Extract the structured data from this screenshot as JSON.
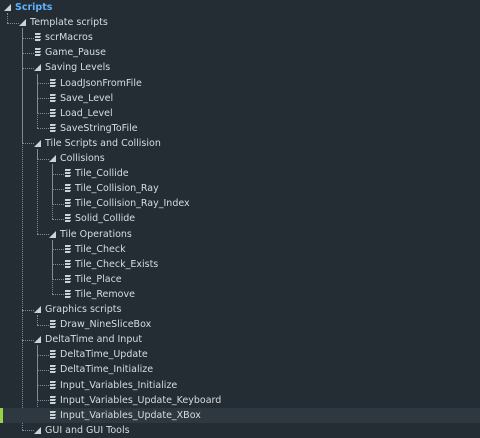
{
  "tree": [
    {
      "label": "Scripts",
      "level": 0,
      "type": "folder",
      "root": true
    },
    {
      "label": "Template scripts",
      "level": 1,
      "type": "folder"
    },
    {
      "label": "scrMacros",
      "level": 2,
      "type": "script"
    },
    {
      "label": "Game_Pause",
      "level": 2,
      "type": "script"
    },
    {
      "label": "Saving Levels",
      "level": 2,
      "type": "folder"
    },
    {
      "label": "LoadJsonFromFile",
      "level": 3,
      "type": "script"
    },
    {
      "label": "Save_Level",
      "level": 3,
      "type": "script"
    },
    {
      "label": "Load_Level",
      "level": 3,
      "type": "script"
    },
    {
      "label": "SaveStringToFile",
      "level": 3,
      "type": "script"
    },
    {
      "label": "Tile Scripts and Collision",
      "level": 2,
      "type": "folder"
    },
    {
      "label": "Collisions",
      "level": 3,
      "type": "folder"
    },
    {
      "label": "Tile_Collide",
      "level": 4,
      "type": "script"
    },
    {
      "label": "Tile_Collision_Ray",
      "level": 4,
      "type": "script"
    },
    {
      "label": "Tile_Collision_Ray_Index",
      "level": 4,
      "type": "script"
    },
    {
      "label": "Solid_Collide",
      "level": 4,
      "type": "script"
    },
    {
      "label": "Tile Operations",
      "level": 3,
      "type": "folder"
    },
    {
      "label": "Tile_Check",
      "level": 4,
      "type": "script"
    },
    {
      "label": "Tile_Check_Exists",
      "level": 4,
      "type": "script"
    },
    {
      "label": "Tile_Place",
      "level": 4,
      "type": "script"
    },
    {
      "label": "Tile_Remove",
      "level": 4,
      "type": "script"
    },
    {
      "label": "Graphics scripts",
      "level": 2,
      "type": "folder"
    },
    {
      "label": "Draw_NineSliceBox",
      "level": 3,
      "type": "script"
    },
    {
      "label": "DeltaTime and Input",
      "level": 2,
      "type": "folder"
    },
    {
      "label": "DeltaTime_Update",
      "level": 3,
      "type": "script"
    },
    {
      "label": "DeltaTime_Initialize",
      "level": 3,
      "type": "script"
    },
    {
      "label": "Input_Variables_Initialize",
      "level": 3,
      "type": "script"
    },
    {
      "label": "Input_Variables_Update_Keyboard",
      "level": 3,
      "type": "script"
    },
    {
      "label": "Input_Variables_Update_XBox",
      "level": 3,
      "type": "script",
      "selected": true
    },
    {
      "label": "GUI and GUI Tools",
      "level": 2,
      "type": "folder"
    }
  ],
  "colors": {
    "background": "#232d33",
    "text": "#d6dde2",
    "root": "#5fb2ff",
    "selection_bar": "#9ad14b",
    "tree_line": "#7f8c95"
  },
  "icons": {
    "folder": "expand-triangle-icon",
    "script": "script-icon"
  }
}
